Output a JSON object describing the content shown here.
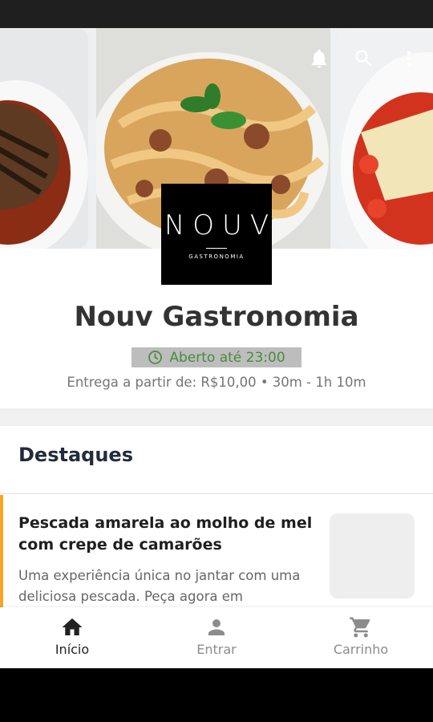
{
  "restaurant": {
    "name": "Nouv Gastronomia",
    "open_status": "Aberto até 23:00",
    "delivery_info": "Entrega a partir de: R$10,00 • 30m - 1h 10m"
  },
  "logo": {
    "word": "NOUV",
    "subtitle": "GASTRONOMIA"
  },
  "section": {
    "title": "Destaques"
  },
  "featured": [
    {
      "title": "Pescada amarela ao molho de mel com crepe de camarões",
      "description": "Uma experiência única no jantar com uma deliciosa pescada. Peça agora em"
    }
  ],
  "nav": [
    {
      "label": "Início",
      "icon": "home-icon",
      "active": true
    },
    {
      "label": "Entrar",
      "icon": "person-icon",
      "active": false
    },
    {
      "label": "Carrinho",
      "icon": "cart-icon",
      "active": false
    }
  ],
  "header_icons": [
    "bell-icon",
    "search-icon",
    "more-vert-icon"
  ],
  "colors": {
    "accent": "#f5a623",
    "open_text": "#4a8b3c",
    "badge_bg": "#bdbdbd"
  }
}
